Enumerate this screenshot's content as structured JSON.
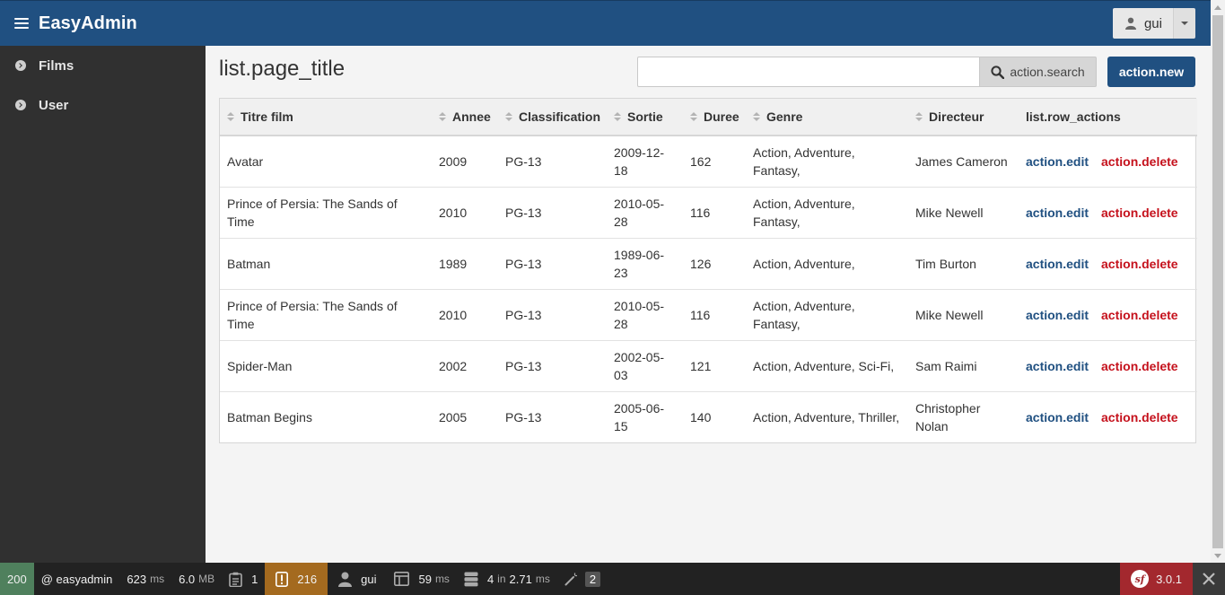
{
  "header": {
    "brand": "EasyAdmin",
    "user_name": "gui"
  },
  "sidebar": {
    "items": [
      {
        "label": "Films"
      },
      {
        "label": "User"
      }
    ]
  },
  "main": {
    "page_title": "list.page_title",
    "search": {
      "value": "",
      "placeholder": "",
      "button_label": "action.search"
    },
    "new_button_label": "action.new"
  },
  "table": {
    "columns": [
      {
        "label": "Titre film",
        "sortable": true
      },
      {
        "label": "Annee",
        "sortable": true
      },
      {
        "label": "Classification",
        "sortable": true
      },
      {
        "label": "Sortie",
        "sortable": true
      },
      {
        "label": "Duree",
        "sortable": true
      },
      {
        "label": "Genre",
        "sortable": true
      },
      {
        "label": "Directeur",
        "sortable": true
      },
      {
        "label": "list.row_actions",
        "sortable": false
      }
    ],
    "rows": [
      {
        "title": "Avatar",
        "year": "2009",
        "classification": "PG-13",
        "release": "2009-12-18",
        "duration": "162",
        "genre": "Action, Adventure, Fantasy,",
        "director": "James Cameron",
        "edit": "action.edit",
        "delete": "action.delete"
      },
      {
        "title": "Prince of Persia: The Sands of Time",
        "year": "2010",
        "classification": "PG-13",
        "release": "2010-05-28",
        "duration": "116",
        "genre": "Action, Adventure, Fantasy,",
        "director": "Mike Newell",
        "edit": "action.edit",
        "delete": "action.delete"
      },
      {
        "title": "Batman",
        "year": "1989",
        "classification": "PG-13",
        "release": "1989-06-23",
        "duration": "126",
        "genre": "Action, Adventure,",
        "director": "Tim Burton",
        "edit": "action.edit",
        "delete": "action.delete"
      },
      {
        "title": "Prince of Persia: The Sands of Time",
        "year": "2010",
        "classification": "PG-13",
        "release": "2010-05-28",
        "duration": "116",
        "genre": "Action, Adventure, Fantasy,",
        "director": "Mike Newell",
        "edit": "action.edit",
        "delete": "action.delete"
      },
      {
        "title": "Spider-Man",
        "year": "2002",
        "classification": "PG-13",
        "release": "2002-05-03",
        "duration": "121",
        "genre": "Action, Adventure, Sci-Fi,",
        "director": "Sam Raimi",
        "edit": "action.edit",
        "delete": "action.delete"
      },
      {
        "title": "Batman Begins",
        "year": "2005",
        "classification": "PG-13",
        "release": "2005-06-15",
        "duration": "140",
        "genre": "Action, Adventure, Thriller,",
        "director": "Christopher Nolan",
        "edit": "action.edit",
        "delete": "action.delete"
      }
    ]
  },
  "toolbar": {
    "status_code": "200",
    "route": "@ easyadmin",
    "time_value": "623",
    "time_unit": "ms",
    "memory_value": "6.0",
    "memory_unit": "MB",
    "forms_count": "1",
    "logs_count": "216",
    "user": "gui",
    "render_value": "59",
    "render_unit": "ms",
    "db_queries": "4",
    "db_in": "in",
    "db_time": "2.71",
    "db_unit": "ms",
    "events_count": "2",
    "symfony_version": "3.0.1"
  },
  "colors": {
    "primary": "#205081",
    "danger": "#c5111c",
    "sidebar": "#303030",
    "status_ok": "#4f805d",
    "warning": "#a46a1f",
    "symfony": "#a3282e"
  }
}
